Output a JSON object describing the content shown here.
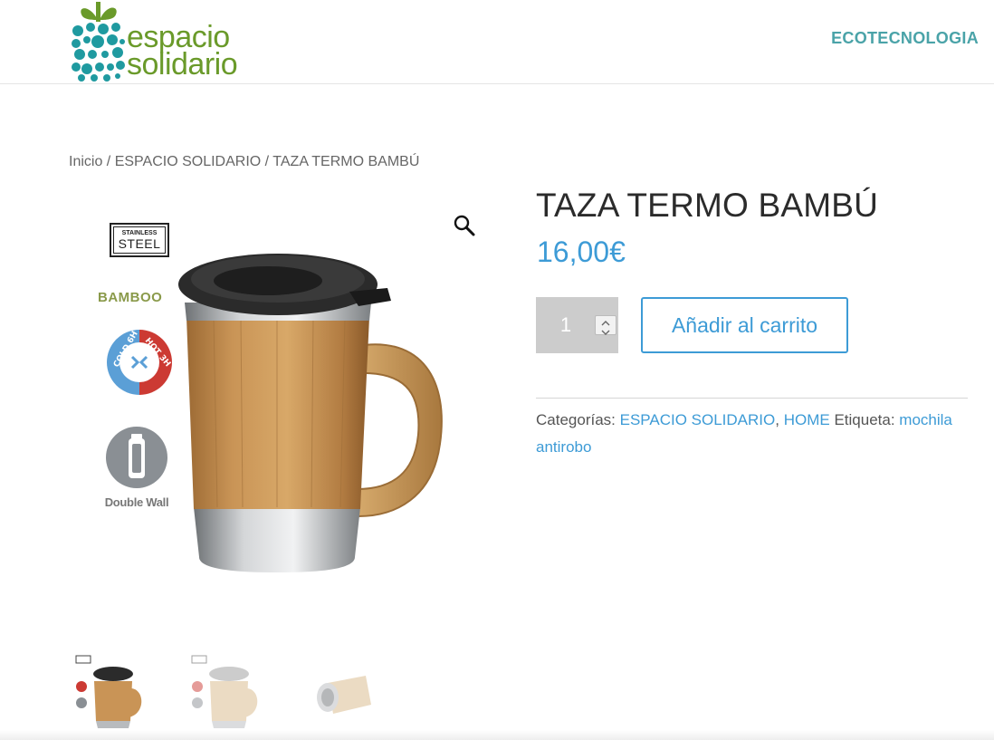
{
  "header": {
    "logo_line1": "espacio",
    "logo_line2": "solidario",
    "nav_link": "ECOTECNOLOGIA"
  },
  "breadcrumb": {
    "home": "Inicio",
    "sep1": " / ",
    "category": "ESPACIO SOLIDARIO",
    "sep2": " / ",
    "current": "TAZA TERMO BAMBÚ"
  },
  "gallery": {
    "zoom_icon": "magnifier-icon",
    "badge_steel_top": "STAINLESS",
    "badge_steel_bottom": "STEEL",
    "badge_bamboo": "BAMBOO",
    "badge_cold": "COLD 6H",
    "badge_hot": "HOT 3H",
    "badge_wall": "Double Wall"
  },
  "product": {
    "title": "TAZA TERMO BAMBÚ",
    "price": "16,00€",
    "quantity": "1",
    "add_to_cart": "Añadir al carrito",
    "categories_label": "Categorías:",
    "category_1": "ESPACIO SOLIDARIO",
    "category_sep": ",",
    "category_2": "HOME",
    "tag_label": "Etiqueta:",
    "tag_1": "mochila antirobo"
  },
  "colors": {
    "accent": "#3d9bd6",
    "nav": "#4aa3a8",
    "logo_green": "#6a9a2a",
    "logo_teal": "#1f9aa0",
    "qty_bg": "#cccccc"
  }
}
